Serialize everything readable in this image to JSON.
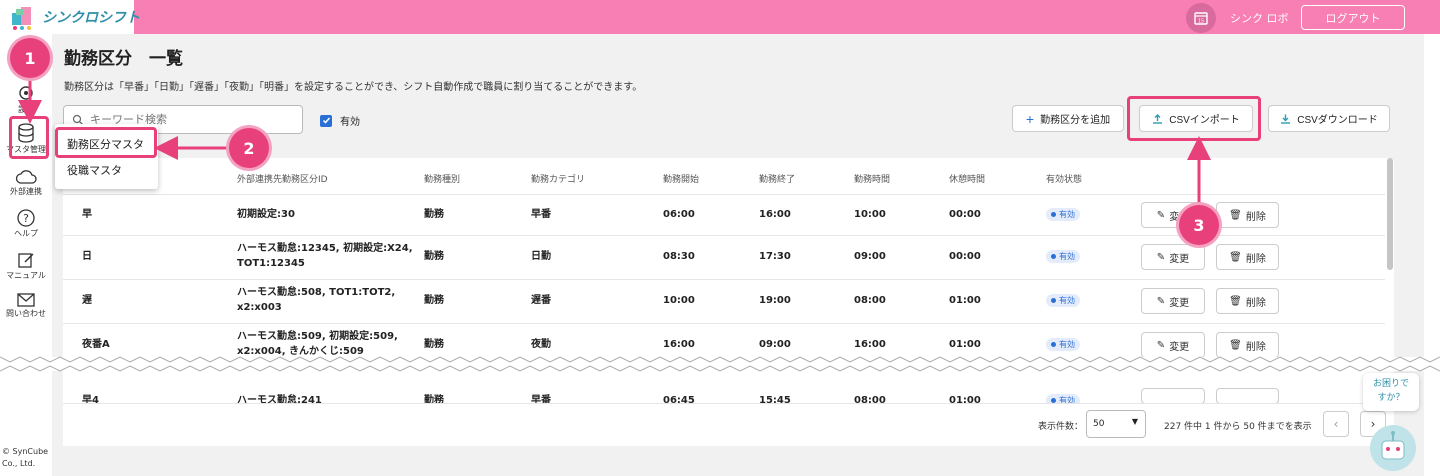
{
  "header": {
    "app_name": "シンクロシフト",
    "calendar_day": "15",
    "user_name": "シンク ロボ",
    "logout_label": "ログアウト"
  },
  "sidebar": {
    "items": [
      {
        "label": "設定",
        "icon": "gear-icon"
      },
      {
        "label": "マスタ管理",
        "icon": "database-icon"
      },
      {
        "label": "外部連携",
        "icon": "cloud-icon"
      },
      {
        "label": "ヘルプ",
        "icon": "help-icon"
      },
      {
        "label": "マニュアル",
        "icon": "edit-icon"
      },
      {
        "label": "問い合わせ",
        "icon": "mail-icon"
      }
    ],
    "copyright_1": "© SynCube",
    "copyright_2": "Co., Ltd."
  },
  "page": {
    "title": "勤務区分　一覧",
    "description": "勤務区分は「早番」「日勤」「遅番」「夜勤」「明番」を設定することができ、シフト自動作成で職員に割り当てることができます。",
    "search_placeholder": "キーワード検索",
    "active_filter_label": "有効",
    "add_button": "勤務区分を追加",
    "import_button": "CSVインポート",
    "download_button": "CSVダウンロード"
  },
  "dropdown": {
    "items": [
      "勤務区分マスタ",
      "役職マスタ"
    ]
  },
  "table": {
    "headers": [
      "外部連携先勤務区分ID",
      "勤務種別",
      "勤務カテゴリ",
      "勤務開始",
      "勤務終了",
      "勤務時間",
      "休憩時間",
      "有効状態"
    ],
    "rows": [
      {
        "name": "早",
        "ext_id": "初期設定:30",
        "ext_id2": "",
        "type": "勤務",
        "category": "早番",
        "start": "06:00",
        "end": "16:00",
        "hours": "10:00",
        "break": "00:00",
        "status": "有効"
      },
      {
        "name": "日",
        "ext_id": "ハーモス勤怠:12345, 初期設定:X24,",
        "ext_id2": "TOT1:12345",
        "type": "勤務",
        "category": "日勤",
        "start": "08:30",
        "end": "17:30",
        "hours": "09:00",
        "break": "00:00",
        "status": "有効"
      },
      {
        "name": "遅",
        "ext_id": "ハーモス勤怠:508, TOT1:TOT2,",
        "ext_id2": "x2:x003",
        "type": "勤務",
        "category": "遅番",
        "start": "10:00",
        "end": "19:00",
        "hours": "08:00",
        "break": "01:00",
        "status": "有効"
      },
      {
        "name": "夜番A",
        "ext_id": "ハーモス勤怠:509, 初期設定:509,",
        "ext_id2": "x2:x004, きんかくじ:509",
        "type": "勤務",
        "category": "夜勤",
        "start": "16:00",
        "end": "09:00",
        "hours": "16:00",
        "break": "01:00",
        "status": "有効"
      },
      {
        "name": "早4",
        "ext_id": "ハーモス勤怠:241",
        "ext_id2": "",
        "type": "勤務",
        "category": "早番",
        "start": "06:45",
        "end": "15:45",
        "hours": "08:00",
        "break": "01:00",
        "status": "有効"
      }
    ],
    "edit_label": "変更",
    "delete_label": "削除"
  },
  "pagination": {
    "per_page_label": "表示件数：",
    "per_page_value": "50",
    "summary": "227 件中 1 件から 50 件までを表示"
  },
  "help_bubble": {
    "line1": "お困りで",
    "line2": "すか？"
  },
  "annotations": [
    "1",
    "2",
    "3"
  ],
  "colors": {
    "header": "#f77fb3",
    "accent": "#e8407a",
    "primary": "#2a6fd6"
  }
}
